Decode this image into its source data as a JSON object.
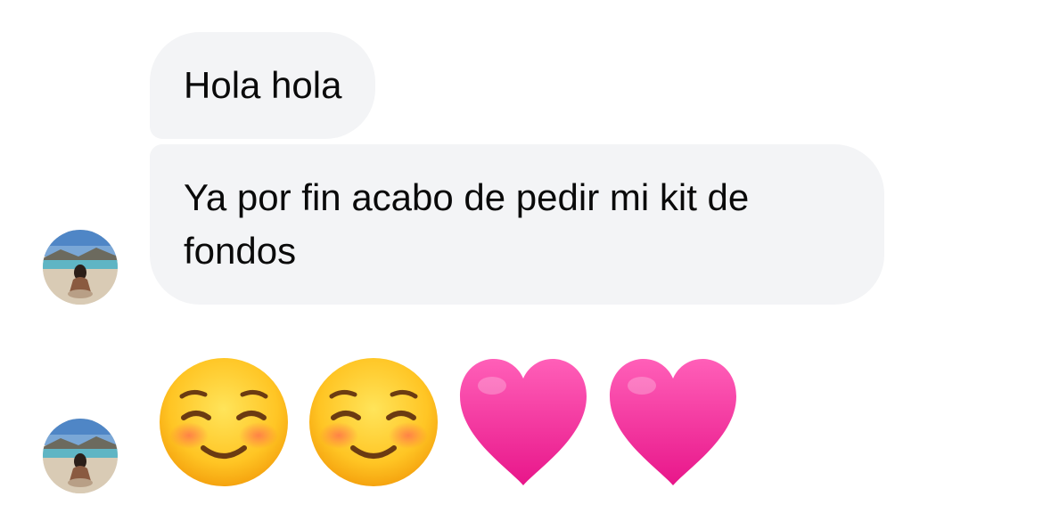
{
  "messages": [
    {
      "text": "Hola hola"
    },
    {
      "text": "Ya por fin acabo de pedir mi kit de fondos"
    }
  ],
  "emoji_message": {
    "icons": [
      "smiling-blush-face",
      "smiling-blush-face",
      "pink-heart",
      "pink-heart"
    ]
  },
  "colors": {
    "bubble_background": "#f3f4f6",
    "text": "#0a0a0a",
    "heart": "#f0339c",
    "face": "#ffc92e"
  }
}
